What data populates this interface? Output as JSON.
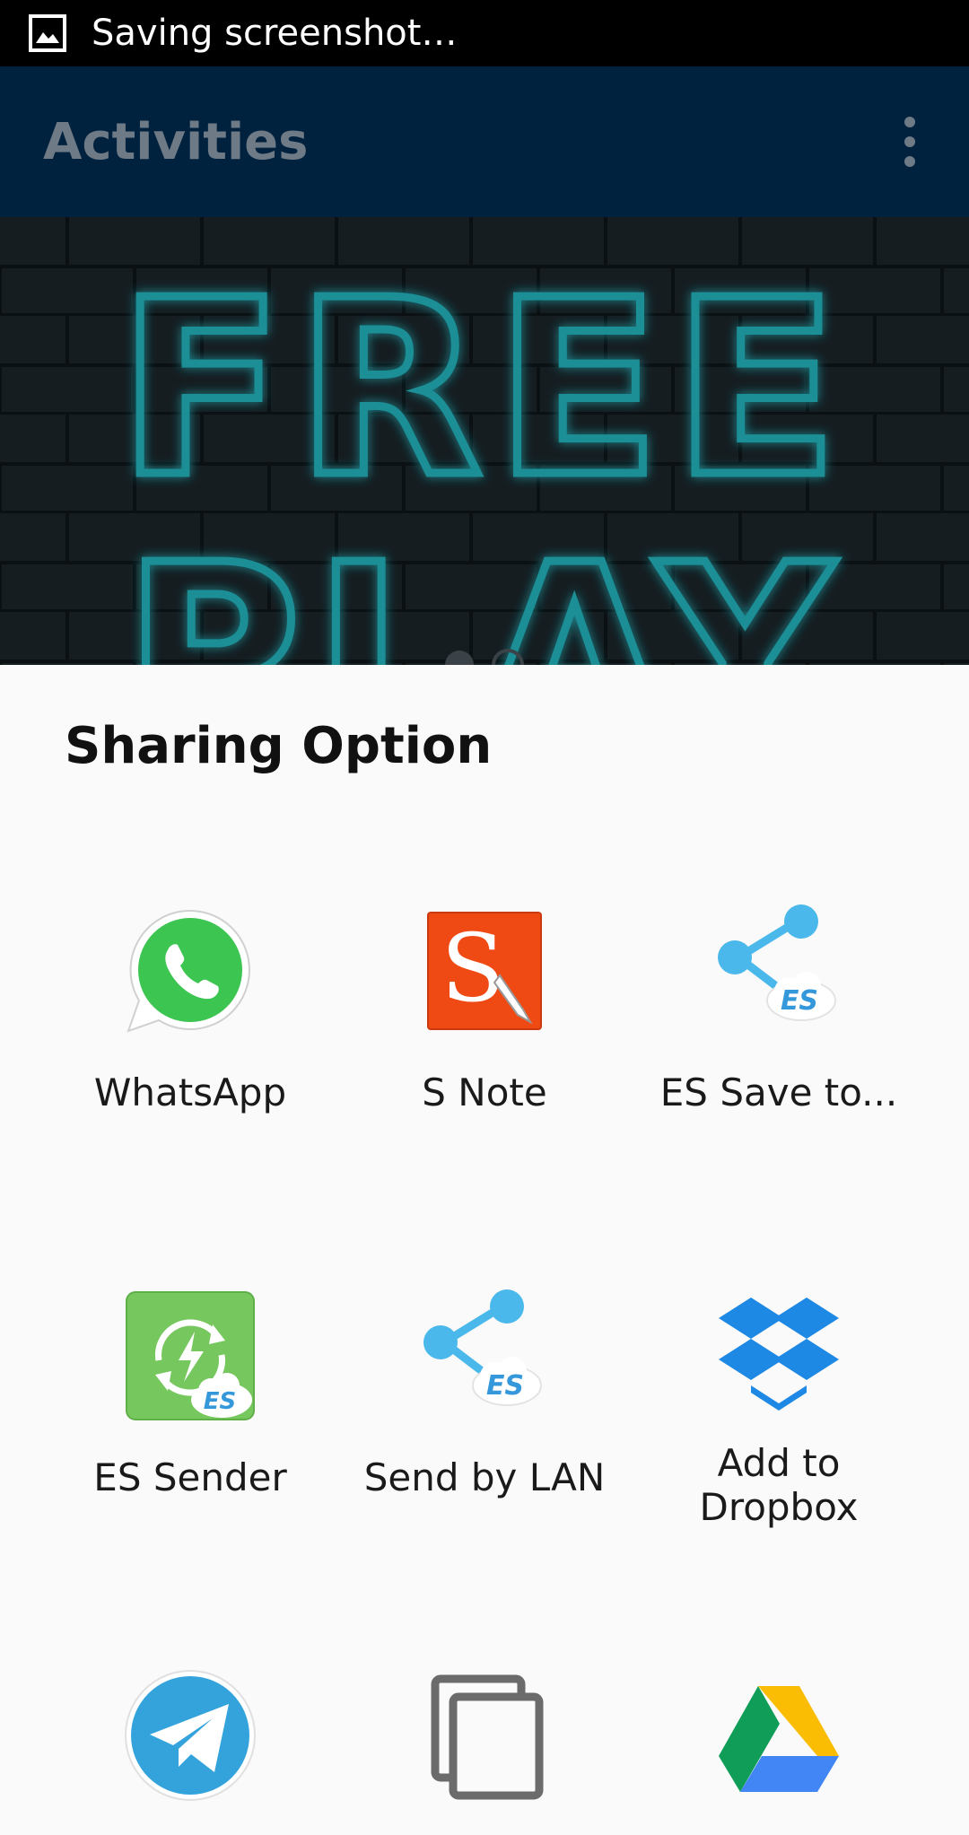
{
  "status_bar": {
    "text": "Saving screenshot…",
    "icon": "image-icon"
  },
  "app_bar": {
    "title": "Activities",
    "menu_icon": "more-vert-icon"
  },
  "banner": {
    "line1": "FREE",
    "line2": "PLAY"
  },
  "share_sheet": {
    "title": "Sharing Option",
    "items": [
      {
        "label": "WhatsApp",
        "icon": "whatsapp-icon"
      },
      {
        "label": "S Note",
        "icon": "s-note-icon"
      },
      {
        "label": "ES Save to...",
        "icon": "es-share-icon"
      },
      {
        "label": "ES Sender",
        "icon": "es-sender-icon"
      },
      {
        "label": "Send by LAN",
        "icon": "es-share-icon"
      },
      {
        "label": "Add to\nDropbox",
        "icon": "dropbox-icon"
      },
      {
        "label": "",
        "icon": "telegram-icon"
      },
      {
        "label": "",
        "icon": "copy-icon"
      },
      {
        "label": "",
        "icon": "google-drive-icon"
      }
    ]
  },
  "colors": {
    "app_bar": "#01223f",
    "neon": "#1e8f96",
    "sheet_bg": "#fafafa"
  }
}
